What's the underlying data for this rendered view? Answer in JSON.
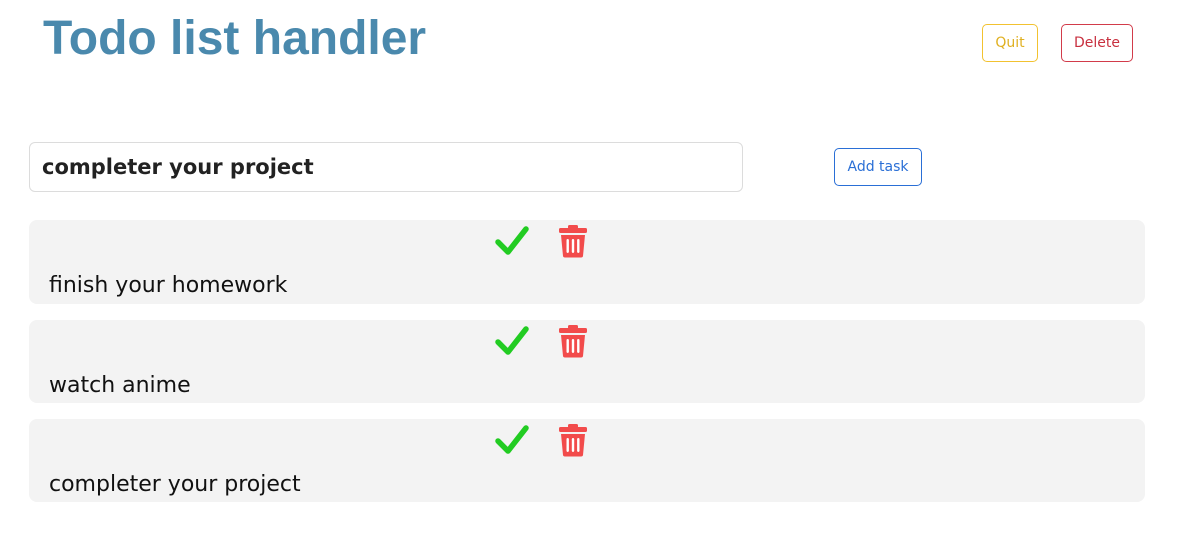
{
  "header": {
    "title": "Todo list handler",
    "quit_label": "Quit",
    "delete_label": "Delete"
  },
  "form": {
    "input_value": "completer your project",
    "add_label": "Add task"
  },
  "tasks": [
    {
      "text": "finish your homework",
      "complete_icon": "check-icon",
      "delete_icon": "trash-icon"
    },
    {
      "text": "watch anime",
      "complete_icon": "check-icon",
      "delete_icon": "trash-icon"
    },
    {
      "text": "completer your project",
      "complete_icon": "check-icon",
      "delete_icon": "trash-icon"
    }
  ],
  "colors": {
    "title": "#4a89ad",
    "quit": "#f2c230",
    "delete": "#d23b4a",
    "add": "#2a6fd6",
    "check": "#22cc22",
    "trash": "#f24b4b",
    "row_background": "#f3f3f3"
  }
}
